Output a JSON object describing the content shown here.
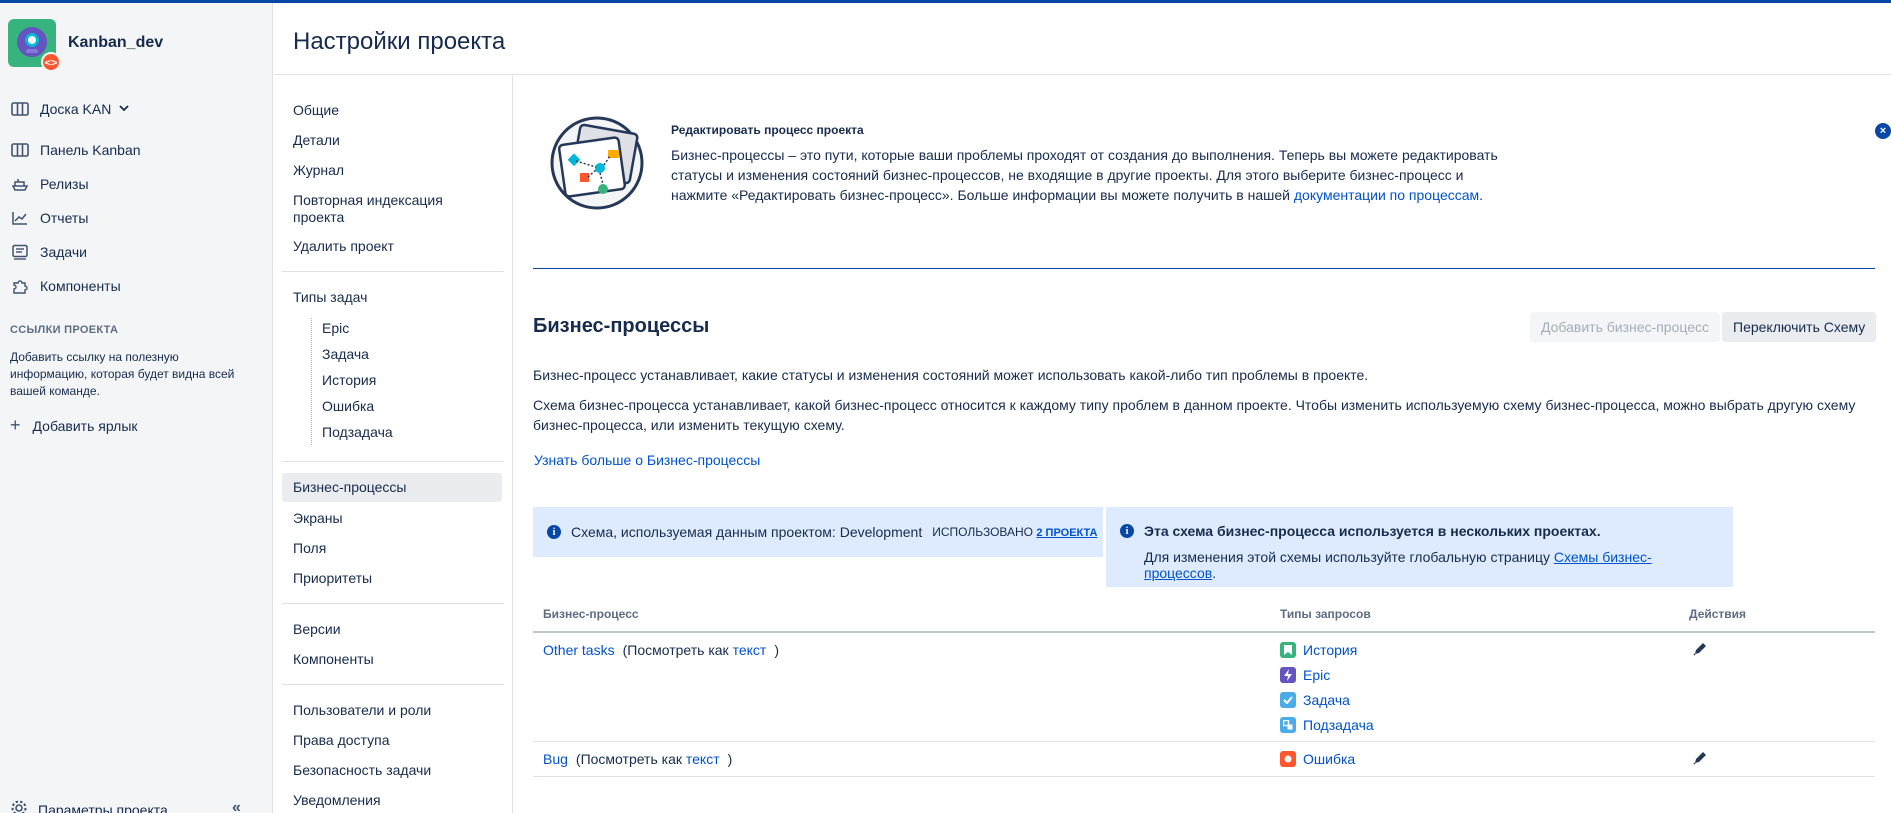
{
  "project": {
    "name": "Kanban_dev",
    "badge_glyph": "<>"
  },
  "sidebar": {
    "board_switcher": "Доска KAN",
    "items": [
      {
        "label": "Панель Kanban",
        "icon": "board-icon"
      },
      {
        "label": "Релизы",
        "icon": "ship-icon"
      },
      {
        "label": "Отчеты",
        "icon": "chart-icon"
      },
      {
        "label": "Задачи",
        "icon": "issues-icon"
      },
      {
        "label": "Компоненты",
        "icon": "puzzle-icon"
      }
    ],
    "links_section_title": "ССЫЛКИ ПРОЕКТА",
    "links_section_desc": "Добавить ссылку на полезную информацию, которая будет видна всей вашей команде.",
    "add_label": "Добавить ярлык",
    "bottom_item": "Параметры проекта",
    "collapse_glyph": "«"
  },
  "header": {
    "title": "Настройки проекта"
  },
  "settings_nav": {
    "general": [
      "Общие",
      "Детали",
      "Журнал",
      "Повторная индексация проекта",
      "Удалить проект"
    ],
    "issue_types_title": "Типы задач",
    "issue_types": [
      "Epic",
      "Задача",
      "История",
      "Ошибка",
      "Подзадача"
    ],
    "group2": [
      "Бизнес-процессы",
      "Экраны",
      "Поля",
      "Приоритеты"
    ],
    "group3": [
      "Версии",
      "Компоненты"
    ],
    "group4": [
      "Пользователи и роли",
      "Права доступа",
      "Безопасность задачи",
      "Уведомления"
    ]
  },
  "banner": {
    "title": "Редактировать процесс проекта",
    "text_before_link": "Бизнес-процессы – это пути, которые ваши проблемы проходят от создания до выполнения. Теперь вы можете редактировать статусы и изменения состояний бизнес-процессов, не входящие в другие проекты. Для этого выберите бизнес-процесс и нажмите «Редактировать бизнес-процесс». Больше информации вы можете получить в нашей ",
    "link": "документации по процессам",
    "text_after_link": ".",
    "close_glyph": "×"
  },
  "workflows": {
    "title": "Бизнес-процессы",
    "add_button": "Добавить бизнес-процесс",
    "switch_button": "Переключить Схему",
    "para1": "Бизнес-процесс устанавливает, какие статусы и изменения состояний может использовать какой-либо тип проблемы в проекте.",
    "para2": "Схема бизнес-процесса устанавливает, какой бизнес-процесс относится к каждому типу проблем в данном проекте. Чтобы изменить используемую схему бизнес-процесса, можно выбрать другую схему бизнес-процесса, или изменить текущую схему.",
    "learn_more": "Узнать больше о Бизнес-процессы",
    "scheme_label": "Схема, используемая данным проектом:",
    "scheme_name": "Development",
    "used_label": "ИСПОЛЬЗОВАНО",
    "used_link": "2 ПРОЕКТА",
    "shared_title": "Эта схема бизнес-процесса используется в нескольких проектах.",
    "shared_desc": "Для изменения этой схемы используйте глобальную страницу ",
    "shared_link": "Схемы бизнес-процессов",
    "shared_after": ".",
    "info_glyph": "i",
    "col_workflow": "Бизнес-процесс",
    "col_types": "Типы запросов",
    "col_actions": "Действия",
    "view_as_prefix": "(Посмотреть как ",
    "view_as_link": "текст",
    "view_as_suffix": ")",
    "rows": [
      {
        "name": "Other tasks",
        "types": [
          {
            "label": "История",
            "color": "#36b37e",
            "icon": "story-icon"
          },
          {
            "label": "Epic",
            "color": "#6554c0",
            "icon": "epic-icon"
          },
          {
            "label": "Задача",
            "color": "#4bade8",
            "icon": "task-icon"
          },
          {
            "label": "Подзадача",
            "color": "#4bade8",
            "icon": "subtask-icon"
          }
        ]
      },
      {
        "name": "Bug",
        "types": [
          {
            "label": "Ошибка",
            "color": "#ff5630",
            "icon": "bug-icon"
          }
        ]
      }
    ]
  },
  "colors": {
    "accent": "#0052cc",
    "info_bg": "#deebff",
    "rule": "#0747a6",
    "topbar": "#0747a6"
  }
}
